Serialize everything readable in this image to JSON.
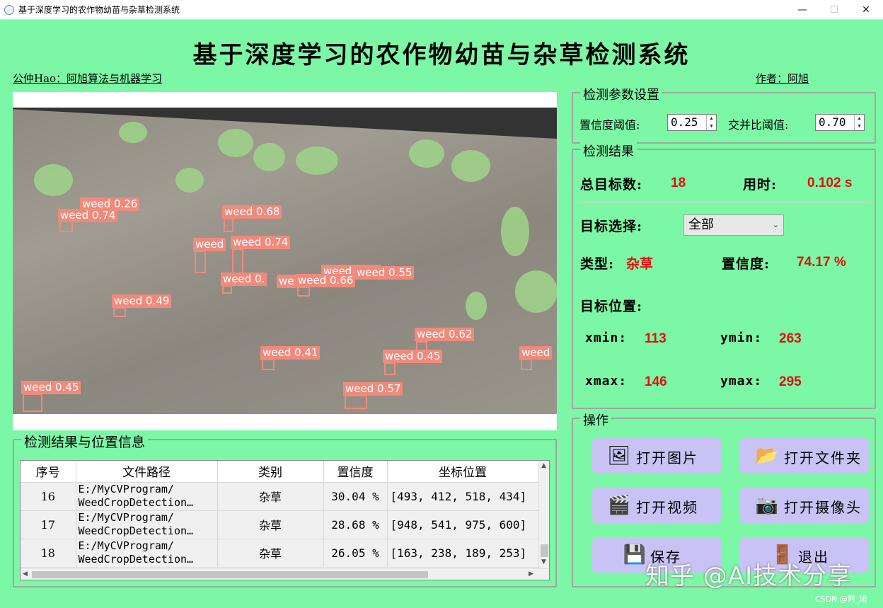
{
  "window": {
    "title": "基于深度学习的农作物幼苗与杂草检测系统",
    "minimize": "—",
    "maximize": "☐",
    "close": "✕"
  },
  "header": {
    "title": "基于深度学习的农作物幼苗与杂草检测系统",
    "left_note": "公仲Hao：阿旭算法与机器学习",
    "right_note": "作者：阿旭"
  },
  "detections": [
    {
      "label": "weed 0.26"
    },
    {
      "label": "weed 0.74"
    },
    {
      "label": "weed 0.68"
    },
    {
      "label": "weed"
    },
    {
      "label": "weed 0.74"
    },
    {
      "label": "weed 0.55"
    },
    {
      "label": "weed 0.55"
    },
    {
      "label": "weed 0."
    },
    {
      "label": "weed 0.66"
    },
    {
      "label": "we"
    },
    {
      "label": "weed 0.49"
    },
    {
      "label": "weed 0.62"
    },
    {
      "label": "weed 0.41"
    },
    {
      "label": "weed 0.45"
    },
    {
      "label": "weed"
    },
    {
      "label": "weed 0.45"
    },
    {
      "label": "weed 0.57"
    }
  ],
  "params": {
    "title": "检测参数设置",
    "conf_label": "置信度阈值:",
    "conf_value": "0.25",
    "iou_label": "交并比阈值:",
    "iou_value": "0.70"
  },
  "results": {
    "title": "检测结果",
    "total_label": "总目标数:",
    "total_value": "18",
    "time_label": "用时:",
    "time_value": "0.102 s",
    "select_label": "目标选择:",
    "select_value": "全部",
    "type_label": "类型:",
    "type_value": "杂草",
    "conf_label": "置信度:",
    "conf_value": "74.17 %",
    "pos_label": "目标位置:",
    "xmin_label": "xmin:",
    "xmin_value": "113",
    "ymin_label": "ymin:",
    "ymin_value": "263",
    "xmax_label": "xmax:",
    "xmax_value": "146",
    "ymax_label": "ymax:",
    "ymax_value": "295"
  },
  "operations": {
    "title": "操作",
    "open_image": "打开图片",
    "open_folder": "打开文件夹",
    "open_video": "打开视频",
    "open_camera": "打开摄像头",
    "save": "保存",
    "exit": "退出"
  },
  "table": {
    "title": "检测结果与位置信息",
    "headers": [
      "序号",
      "文件路径",
      "类别",
      "置信度",
      "坐标位置"
    ],
    "rows": [
      {
        "id": "16",
        "path1": "E:/MyCVProgram/",
        "path2": "WeedCropDetection…",
        "cls": "杂草",
        "conf": "30.04 %",
        "coord": "[493, 412, 518, 434]"
      },
      {
        "id": "17",
        "path1": "E:/MyCVProgram/",
        "path2": "WeedCropDetection…",
        "cls": "杂草",
        "conf": "28.68 %",
        "coord": "[948, 541, 975, 600]"
      },
      {
        "id": "18",
        "path1": "E:/MyCVProgram/",
        "path2": "WeedCropDetection…",
        "cls": "杂草",
        "conf": "26.05 %",
        "coord": "[163, 238, 189, 253]"
      }
    ]
  },
  "watermark": "知乎 @AI技术分享",
  "csdn": "CSDN @阿_旭",
  "colors": {
    "background": "#7cf7a6",
    "button": "#c9c3f5",
    "value_red": "#e01010",
    "box": "#f08a7c"
  }
}
